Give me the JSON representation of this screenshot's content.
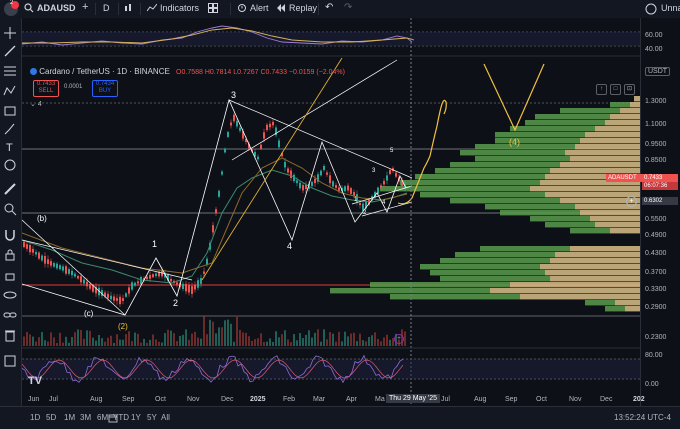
{
  "toolbar": {
    "symbol": "ADAUSD",
    "interval": "D",
    "indicators_label": "Indicators",
    "alert_label": "Alert",
    "replay_label": "Replay",
    "user_label": "Unna",
    "notification_count": "2"
  },
  "legend": {
    "title": "Cardano / TetherUS · 1D · BINANCE",
    "ohlc_text": "O0.7588 H0.7814 L0.7267 C0.7433 −0.0159 (−2.04%)",
    "sell_price": "0.7433",
    "sell_label": "SELL",
    "buy_price": "0.7434",
    "buy_label": "BUY",
    "spread": "0.0001",
    "indicator_count": "4"
  },
  "price_scale": {
    "currency": "USDT",
    "top_osc_labels": [
      "60.00",
      "40.00"
    ],
    "labels": [
      "1.3000",
      "1.1000",
      "0.9500",
      "0.8500",
      "0.5500",
      "0.4900",
      "0.4300",
      "0.3700",
      "0.3300",
      "0.2900",
      "0.2300"
    ],
    "last_price_symbol": "ADAUSDT",
    "last_price": "0.7433",
    "countdown": "06:07:36",
    "crosshair_price": "0.6302",
    "bottom_osc_labels": [
      "80.00",
      "0.00"
    ]
  },
  "time_axis": {
    "labels": [
      "Jun",
      "Jul",
      "Aug",
      "Sep",
      "Oct",
      "Nov",
      "Dec",
      "2025",
      "Feb",
      "Mar",
      "Apr",
      "Ma",
      "Jul",
      "Aug",
      "Sep",
      "Oct",
      "Nov",
      "Dec",
      "202"
    ],
    "cursor_date": "Thu 29 May '25"
  },
  "annotations": {
    "wave_labels": [
      "(b)",
      "1",
      "2",
      "(c)",
      "(2)",
      "3",
      "4",
      "5",
      "3",
      "1",
      "2",
      "4",
      "(4)",
      "5"
    ]
  },
  "bottom_bar": {
    "timeframes": [
      "1D",
      "5D",
      "1M",
      "3M",
      "6M",
      "YTD",
      "1Y",
      "5Y",
      "All"
    ],
    "clock": "13:52:24 UTC-4"
  },
  "colors": {
    "bg": "#0d1017",
    "bull": "#26a69a",
    "bear": "#ef5350",
    "volume_profile_up": "#5b9b4f",
    "volume_profile_down": "#d8c08a",
    "wave_line": "#ffffff",
    "projection": "#f0c040",
    "oscillator": "#7e57c2",
    "red_line": "#e53935"
  }
}
